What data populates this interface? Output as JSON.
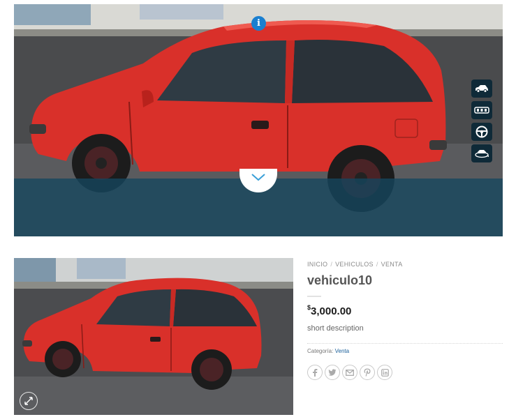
{
  "viewer": {
    "info_glyph": "i",
    "view_icons": [
      "car-side-view-icon",
      "car-interior-seats-icon",
      "steering-wheel-icon",
      "car-360-icon"
    ],
    "pull_icon": "chevron-down-icon"
  },
  "thumbnail": {
    "zoom_icon": "expand-icon"
  },
  "breadcrumb": {
    "items": [
      "INICIO",
      "VEHICULOS",
      "VENTA"
    ],
    "separator": "/"
  },
  "product": {
    "title": "vehiculo10",
    "currency": "$",
    "price": "3,000.00",
    "short_description": "short description",
    "category_label": "Categoría:",
    "category": "Venta"
  },
  "share": {
    "icons": [
      "facebook-icon",
      "twitter-icon",
      "email-icon",
      "pinterest-icon",
      "linkedin-icon"
    ]
  },
  "colors": {
    "car_red": "#d9302a",
    "accent_blue": "#1a7fd0",
    "overlay": "#14465f",
    "link": "#1a5f9a"
  }
}
